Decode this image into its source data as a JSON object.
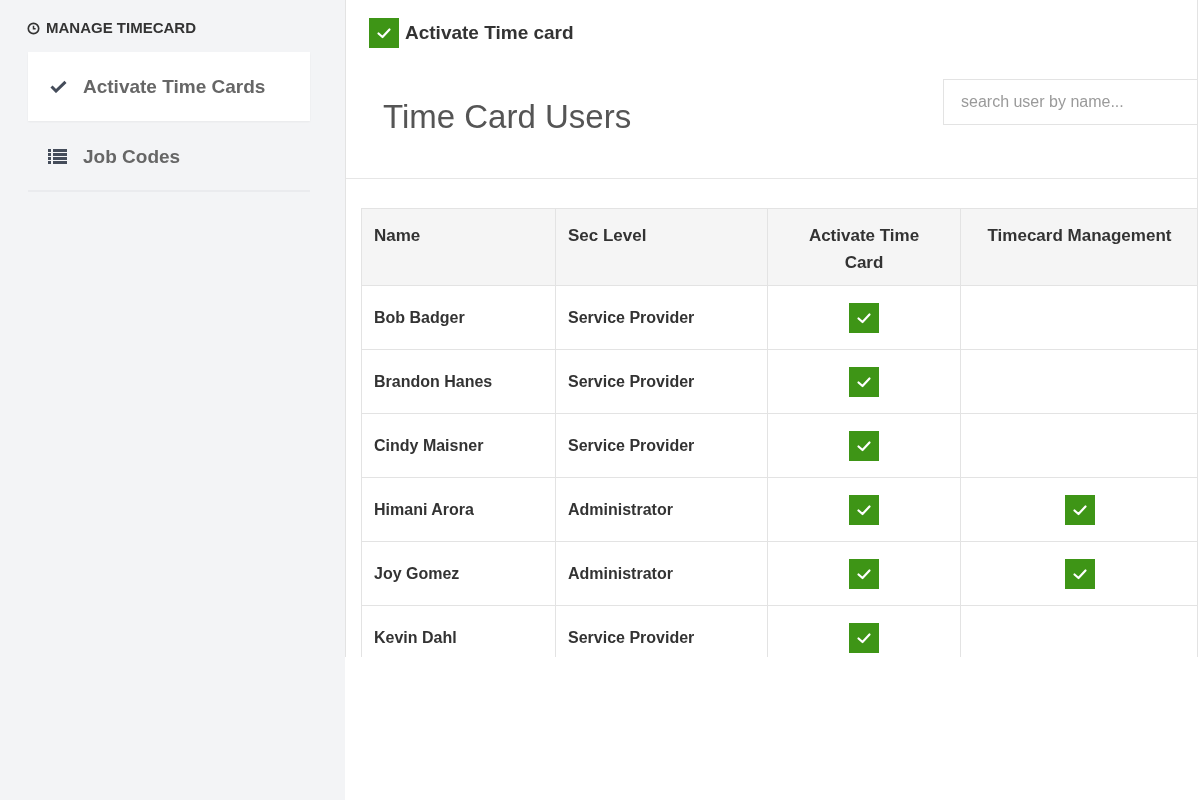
{
  "sidebar": {
    "heading": "MANAGE TIMECARD",
    "items": [
      {
        "label": "Activate Time Cards",
        "kind": "check",
        "selected": true
      },
      {
        "label": "Job Codes",
        "kind": "list",
        "selected": false
      }
    ]
  },
  "activate_toggle": {
    "label": "Activate Time card",
    "checked": true
  },
  "title": "Time Card Users",
  "search": {
    "placeholder": "search user by name..."
  },
  "table": {
    "columns": [
      "Name",
      "Sec Level",
      "Activate Time Card",
      "Timecard Management"
    ],
    "rows": [
      {
        "name": "Bob Badger",
        "sec_level": "Service Provider",
        "activate_time_card": true,
        "timecard_management": false
      },
      {
        "name": "Brandon Hanes",
        "sec_level": "Service Provider",
        "activate_time_card": true,
        "timecard_management": false
      },
      {
        "name": "Cindy Maisner",
        "sec_level": "Service Provider",
        "activate_time_card": true,
        "timecard_management": false
      },
      {
        "name": "Himani Arora",
        "sec_level": "Administrator",
        "activate_time_card": true,
        "timecard_management": true
      },
      {
        "name": "Joy Gomez",
        "sec_level": "Administrator",
        "activate_time_card": true,
        "timecard_management": true
      },
      {
        "name": "Kevin Dahl",
        "sec_level": "Service Provider",
        "activate_time_card": true,
        "timecard_management": false
      }
    ]
  }
}
